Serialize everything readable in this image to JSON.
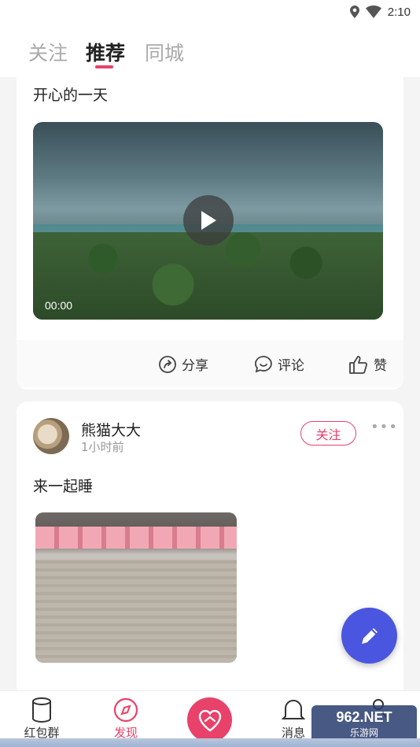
{
  "status_bar": {
    "time": "2:10"
  },
  "top_tabs": [
    {
      "label": "关注",
      "active": false
    },
    {
      "label": "推荐",
      "active": true
    },
    {
      "label": "同城",
      "active": false
    }
  ],
  "post1": {
    "text": "开心的一天",
    "video_time": "00:00",
    "actions": {
      "share": "分享",
      "comment": "评论",
      "like": "赞"
    }
  },
  "post2": {
    "username": "熊猫大大",
    "time": "1小时前",
    "follow_label": "关注",
    "text": "来一起睡"
  },
  "bottom_nav": {
    "items": [
      {
        "label": "红包群"
      },
      {
        "label": "发现"
      },
      {
        "label": "消息"
      }
    ]
  },
  "watermark": {
    "logo": "962.NET",
    "sub": "乐游网"
  },
  "colors": {
    "accent": "#e8416a",
    "fab": "#4a55e0"
  }
}
